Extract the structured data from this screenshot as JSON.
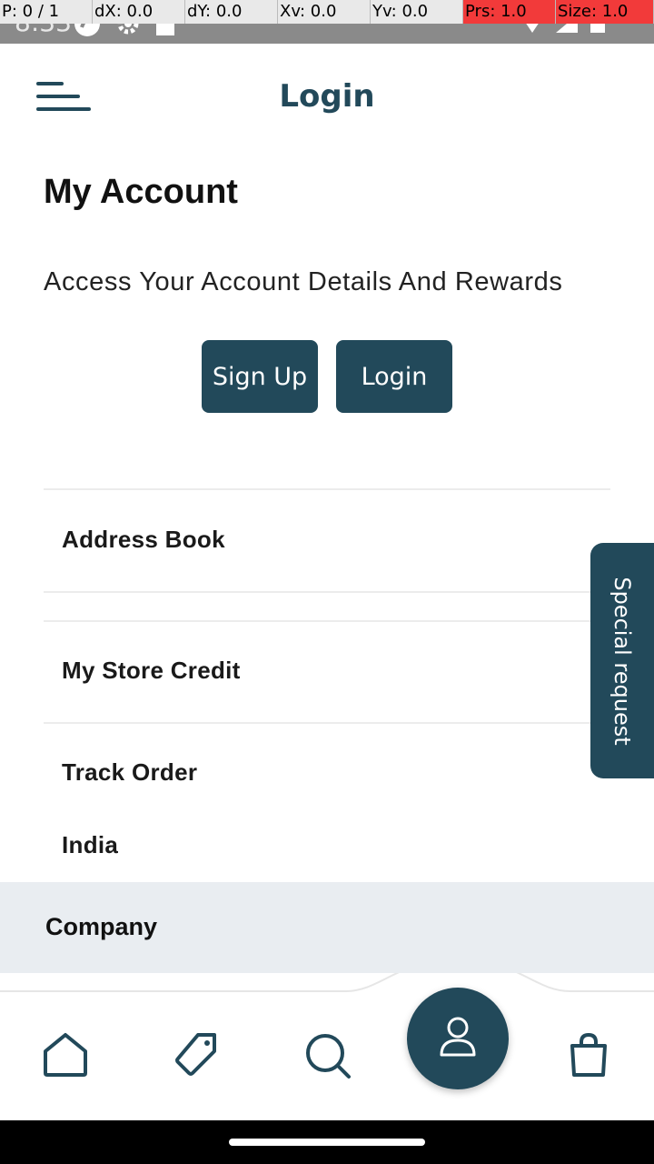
{
  "status_bar": {
    "time": "8:33"
  },
  "debug_overlay": [
    "P: 0 / 1",
    "dX: 0.0",
    "dY: 0.0",
    "Xv: 0.0",
    "Yv: 0.0",
    "Prs: 1.0",
    "Size: 1.0"
  ],
  "appbar": {
    "title": "Login"
  },
  "page": {
    "title": "My Account",
    "subtitle": "Access Your Account Details And Rewards"
  },
  "buttons": {
    "signup": "Sign Up",
    "login": "Login"
  },
  "menu_items": [
    "Address Book",
    "My Store Credit",
    "Track Order",
    "India"
  ],
  "special_request": "Special request",
  "section": {
    "company": "Company"
  },
  "colors": {
    "primary": "#22495a",
    "section_bg": "#e9edf1"
  },
  "nav": {
    "icons": [
      "home-icon",
      "tag-icon",
      "search-icon",
      "user-icon",
      "shopping-bag-icon"
    ],
    "active": "user-icon"
  }
}
